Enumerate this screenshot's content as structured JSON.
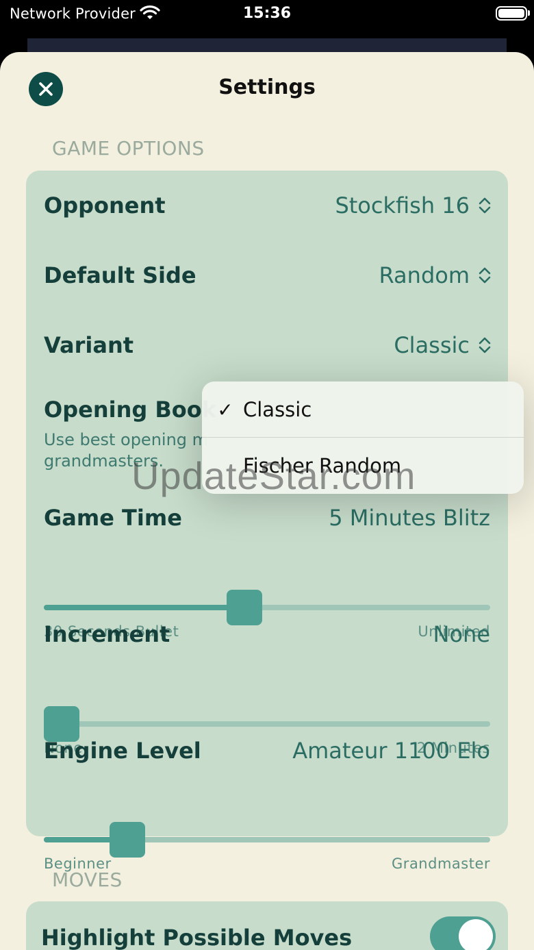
{
  "status_bar": {
    "carrier": "Network Provider",
    "time": "15:36"
  },
  "sheet": {
    "title": "Settings"
  },
  "game_options": {
    "header": "GAME OPTIONS",
    "opponent": {
      "label": "Opponent",
      "value": "Stockfish 16"
    },
    "default_side": {
      "label": "Default Side",
      "value": "Random"
    },
    "variant": {
      "label": "Variant",
      "value": "Classic"
    },
    "opening_book": {
      "label": "Opening Book",
      "description_line1": "Use best opening m",
      "description_line2": "grandmasters."
    },
    "game_time": {
      "label": "Game Time",
      "value": "5 Minutes Blitz",
      "min_label": "30 Seconds Bullet",
      "max_label": "Unlimited",
      "position": 0.445
    },
    "increment": {
      "label": "Increment",
      "value": "None",
      "min_label": "None",
      "max_label": "2 Minutes",
      "position": 0.0
    },
    "engine_level": {
      "label": "Engine Level",
      "value": "Amateur 1100 Elo",
      "min_label": "Beginner",
      "max_label": "Grandmaster",
      "position": 0.16
    }
  },
  "moves": {
    "header": "MOVES",
    "highlight_possible_moves": {
      "label": "Highlight Possible Moves",
      "on": true
    }
  },
  "variant_menu": {
    "options": [
      {
        "label": "Classic",
        "checkmark": "✓"
      },
      {
        "label": "Fischer Random"
      }
    ]
  },
  "watermark": "UpdateStar.com",
  "colors": {
    "sheet_bg": "#f3f0df",
    "card_bg": "#c7dccb",
    "accent": "#4ea092",
    "label_text": "#153f3a",
    "close_button": "#0e4d47"
  }
}
